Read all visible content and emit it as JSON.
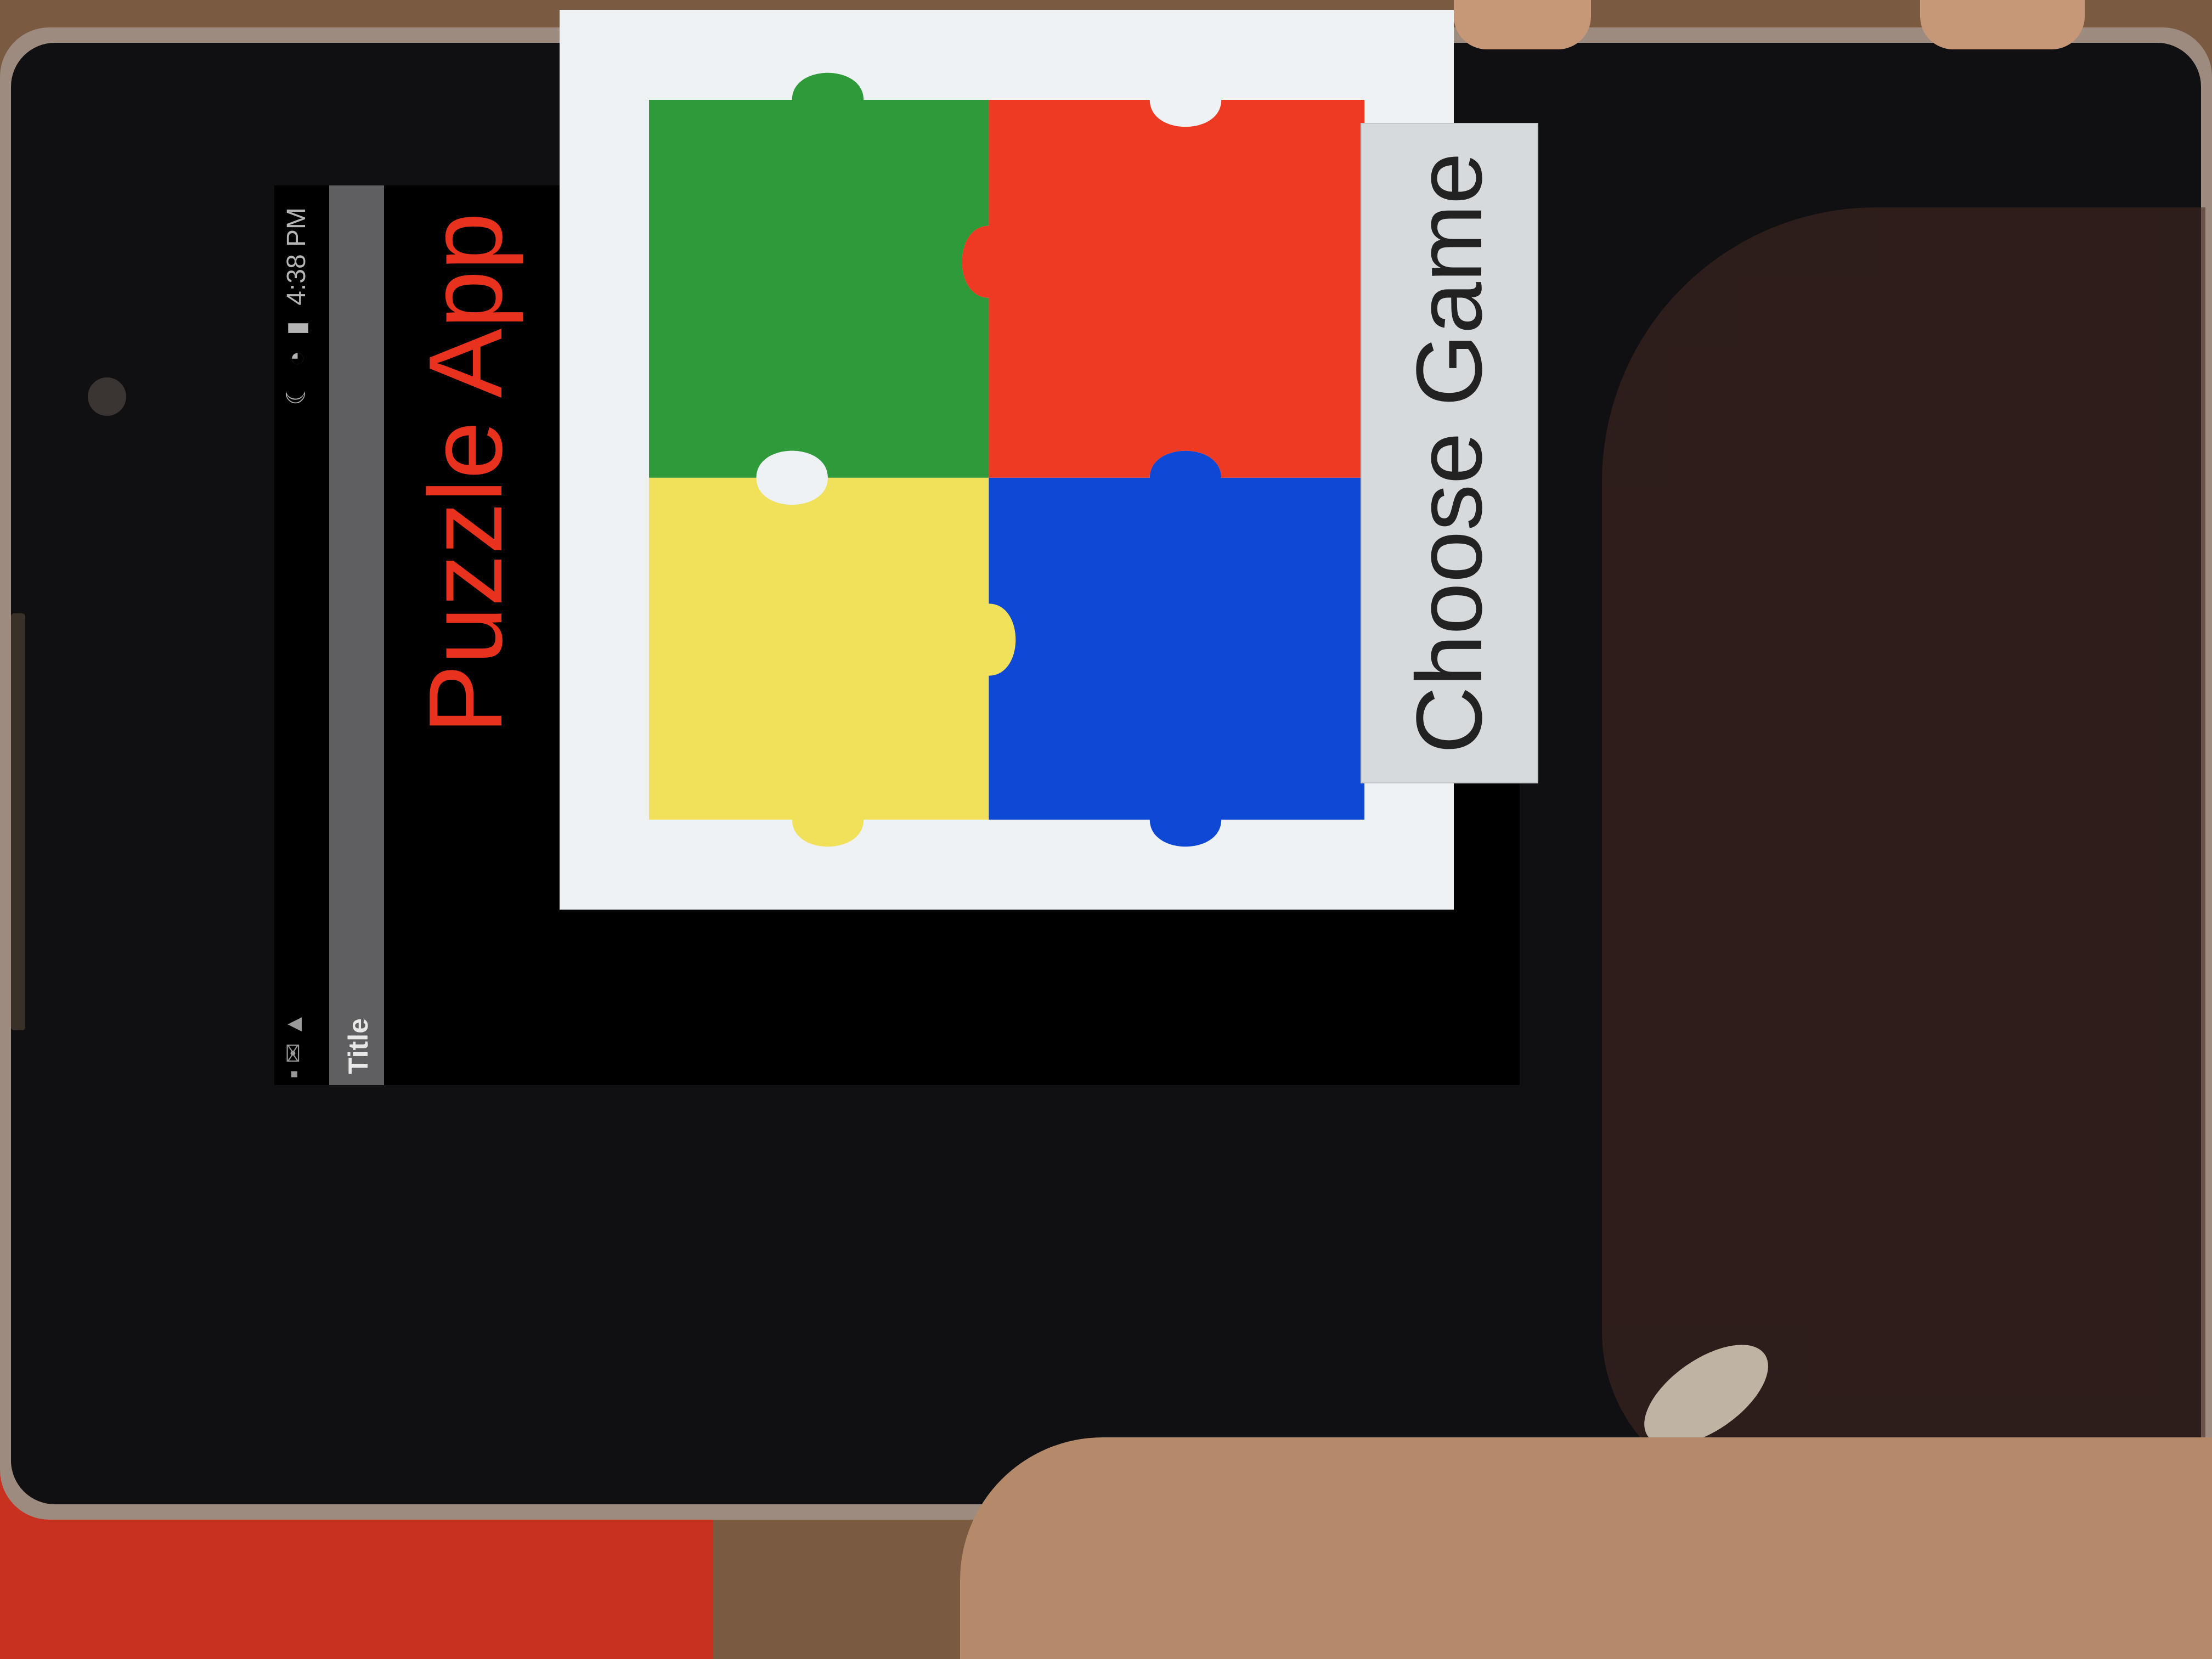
{
  "status_bar": {
    "left_icons": [
      "notification-icon",
      "mail-icon",
      "alert-icon"
    ],
    "right_icons": [
      "moon-icon",
      "wifi-icon",
      "battery-icon"
    ],
    "time": "4:38 PM"
  },
  "action_bar": {
    "title": "Title"
  },
  "app": {
    "title": "Puzzle App",
    "title_color": "#e8321d",
    "image": "jigsaw-puzzle-four-pieces",
    "piece_colors": {
      "yellow": "#f0e05a",
      "green": "#2f9a3a",
      "blue": "#1048d6",
      "red": "#ee3a22"
    },
    "button_label": "Choose Game"
  }
}
